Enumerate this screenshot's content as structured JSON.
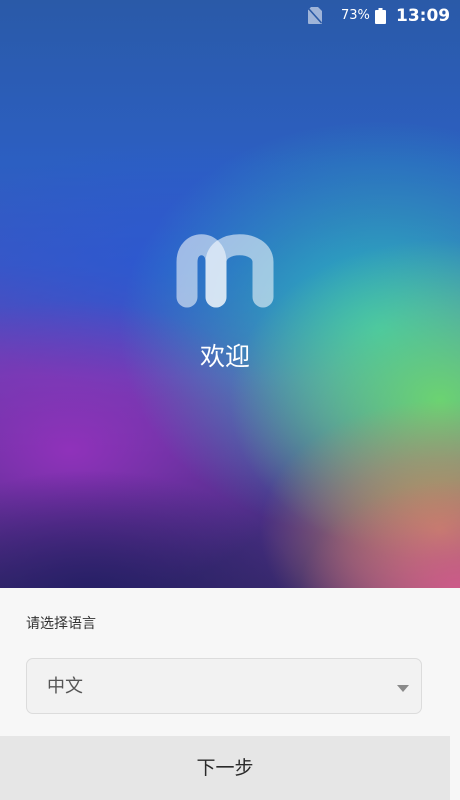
{
  "status_bar": {
    "sim_icon": "no-sim-icon",
    "battery_percent": "73%",
    "battery_icon": "battery-icon",
    "time": "13:09"
  },
  "hero": {
    "logo_icon": "m-logo",
    "welcome_text": "欢迎"
  },
  "language": {
    "prompt": "请选择语言",
    "selected": "中文",
    "dropdown_icon": "chevron-down-icon"
  },
  "footer": {
    "next_label": "下一步"
  },
  "colors": {
    "panel_background": "#f7f7f7",
    "select_background": "#f2f2f2",
    "button_background": "#e6e6e6",
    "text_primary": "#2a2a2a"
  }
}
